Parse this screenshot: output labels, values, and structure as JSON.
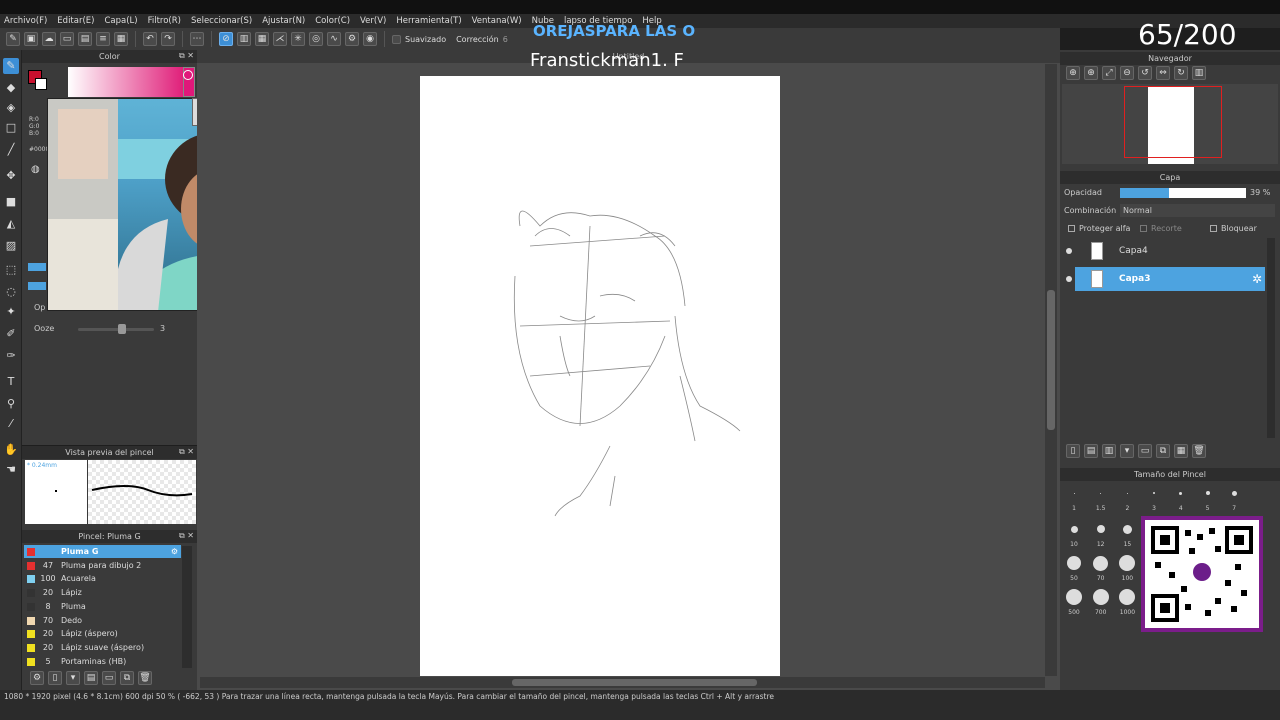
{
  "menu": [
    "Archivo(F)",
    "Editar(E)",
    "Capa(L)",
    "Filtro(R)",
    "Seleccionar(S)",
    "Ajustar(N)",
    "Color(C)",
    "Ver(V)",
    "Herramienta(T)",
    "Ventana(W)",
    "Nube",
    "lapso de tiempo",
    "Help"
  ],
  "toolbar": {
    "suavizado_label": "Suavizado",
    "correccion_label": "Corrección",
    "correccion_value": "6"
  },
  "panels": {
    "color_title": "Color",
    "canvas_title": "Untitled",
    "navigator_title": "Navegador",
    "layer_title": "Capa",
    "brush_preview_title": "Vista previa del pincel",
    "brush_preview_size": "* 0.24mm",
    "brush_list_title": "Pincel: Pluma G",
    "brush_size_title": "Tamaño del Pincel"
  },
  "color": {
    "r": "R:0",
    "g": "G:0",
    "b": "B:0",
    "hex": "#0000",
    "accent": "#e0187a"
  },
  "brush_settings": {
    "ooze_label": "Ooze",
    "ooze_value": "3",
    "op_label": "Op"
  },
  "layers": {
    "opacity_label": "Opacidad",
    "opacity_value": "39 %",
    "opacity_fraction": 0.39,
    "blend_label": "Combinación",
    "blend_value": "Normal",
    "protect_alpha": "Proteger alfa",
    "clip": "Recorte",
    "lock": "Bloquear",
    "items": [
      {
        "name": "Capa4"
      },
      {
        "name": "Capa3"
      }
    ]
  },
  "brushes": [
    {
      "size": "",
      "name": "Pluma G",
      "color": "#e53030"
    },
    {
      "size": "47",
      "name": "Pluma para dibujo 2",
      "color": "#e53030"
    },
    {
      "size": "100",
      "name": "Acuarela",
      "color": "#7fd0f0"
    },
    {
      "size": "20",
      "name": "Lápiz",
      "color": "#333333"
    },
    {
      "size": "8",
      "name": "Pluma",
      "color": "#333333"
    },
    {
      "size": "70",
      "name": "Dedo",
      "color": "#f0d8b0"
    },
    {
      "size": "20",
      "name": "Lápiz (áspero)",
      "color": "#f0e020"
    },
    {
      "size": "20",
      "name": "Lápiz suave (áspero)",
      "color": "#f0e020"
    },
    {
      "size": "5",
      "name": "Portaminas (HB)",
      "color": "#f0e020"
    }
  ],
  "brush_sizes": {
    "row1": [
      "1",
      "1.5",
      "2",
      "3",
      "4",
      "5",
      "7"
    ],
    "row2": [
      "10",
      "12",
      "15"
    ],
    "row3": [
      "50",
      "70",
      "100"
    ],
    "row4": [
      "500",
      "700",
      "1000"
    ]
  },
  "status": "1080 * 1920 pixel  (4.6 * 8.1cm)  600 dpi  50 %  ( -662, 53 )  Para trazar una línea recta, mantenga pulsada la tecla Mayús. Para cambiar el tamaño del pincel, mantenga pulsada las teclas Ctrl + Alt y arrastre",
  "overlay": {
    "counter": "65/200",
    "banner": "OREJASPARA LAS O",
    "credit": "Franstickman1. F"
  }
}
